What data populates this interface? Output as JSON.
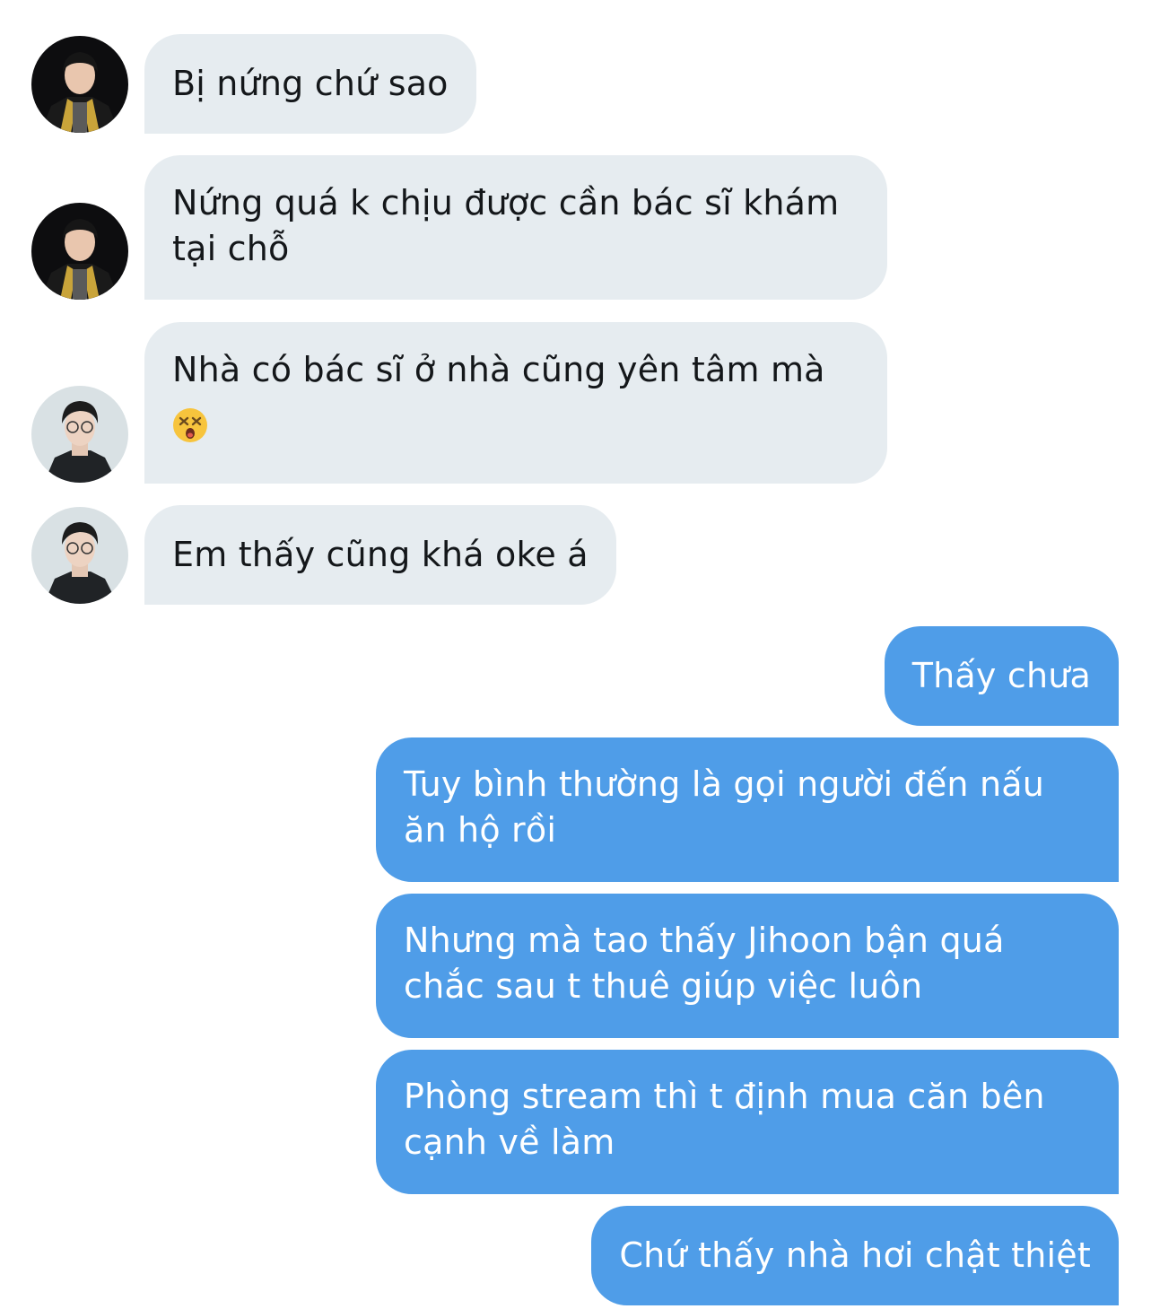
{
  "conversation": {
    "messages": [
      {
        "direction": "incoming",
        "avatar": "avatar-player-a",
        "lines": [
          "Bị nứng chứ sao"
        ]
      },
      {
        "direction": "incoming",
        "avatar": "avatar-player-a",
        "lines": [
          "Nứng quá k chịu được cần bác sĩ khám",
          "tại chỗ"
        ]
      },
      {
        "direction": "incoming",
        "avatar": "avatar-player-b",
        "lines": [
          "Nhà có bác sĩ ở nhà cũng yên tâm mà"
        ],
        "emoji": "dizzy-face-emoji"
      },
      {
        "direction": "incoming",
        "avatar": "avatar-player-b",
        "lines": [
          "Em thấy cũng khá oke á"
        ]
      },
      {
        "direction": "outgoing",
        "lines": [
          "Thấy chưa"
        ]
      },
      {
        "direction": "outgoing",
        "lines": [
          "Tuy bình thường là gọi người đến nấu",
          "ăn hộ rồi"
        ]
      },
      {
        "direction": "outgoing",
        "lines": [
          "Nhưng mà tao thấy Jihoon bận quá",
          "chắc sau t thuê giúp việc luôn"
        ]
      },
      {
        "direction": "outgoing",
        "lines": [
          "Phòng stream thì t định mua căn bên",
          "cạnh về làm"
        ]
      },
      {
        "direction": "outgoing",
        "lines": [
          "Chứ thấy nhà hơi chật thiệt"
        ]
      }
    ]
  },
  "colors": {
    "incoming_bubble": "#e6ecf0",
    "incoming_text": "#14171a",
    "outgoing_bubble": "#4f9de8",
    "outgoing_text": "#ffffff",
    "background": "#ffffff"
  }
}
